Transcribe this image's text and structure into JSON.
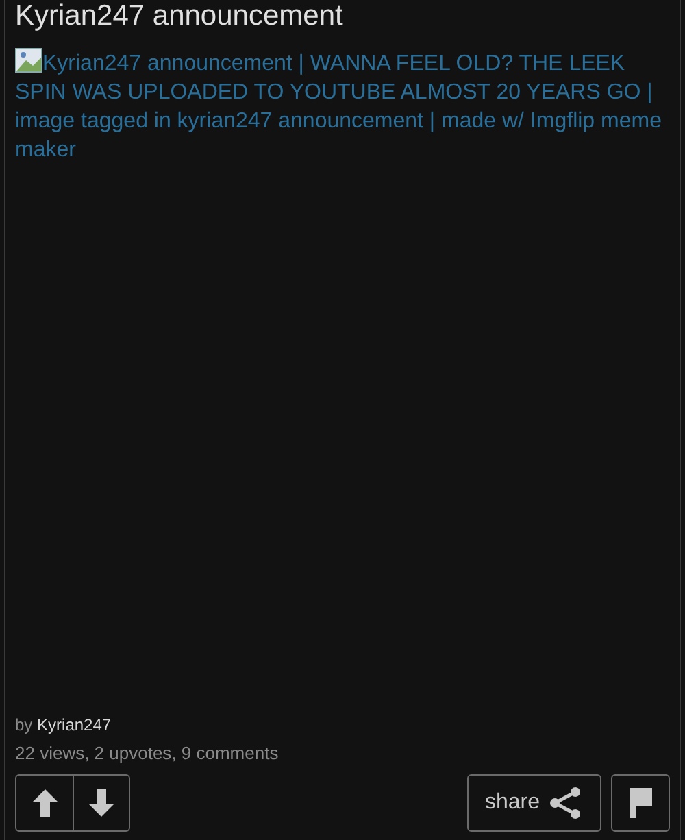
{
  "post": {
    "title": "Kyrian247 announcement",
    "image_alt": "Kyrian247 announcement | WANNA FEEL OLD? THE LEEK SPIN WAS UPLOADED TO YOUTUBE ALMOST 20 YEARS GO | image tagged in kyrian247 announcement | made w/ Imgflip meme maker",
    "by_label": "by",
    "author": "Kyrian247",
    "stats": "22 views, 2 upvotes, 9 comments"
  },
  "actions": {
    "share_label": "share"
  }
}
